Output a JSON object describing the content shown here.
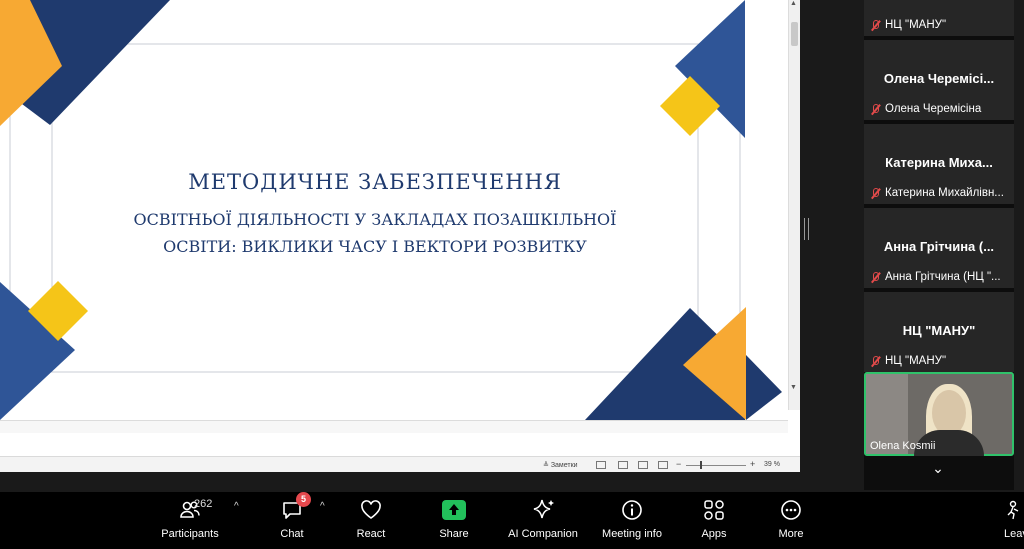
{
  "slide": {
    "title": "МЕТОДИЧНЕ ЗАБЕЗПЕЧЕННЯ",
    "subtitle_line1": "ОСВІТНЬОЇ ДІЯЛЬНОСТІ У ЗАКЛАДАХ ПОЗАШКІЛЬНОЇ",
    "subtitle_line2": "ОСВІТИ: ВИКЛИКИ ЧАСУ І ВЕКТОРИ РОЗВИТКУ",
    "colors": {
      "navy": "#1f3a6e",
      "yellow": "#f5c518",
      "orange": "#f7a933",
      "blue": "#2f5597"
    }
  },
  "ppt_status": {
    "notes_label": "Заметки",
    "zoom": "39 %"
  },
  "gallery": [
    {
      "display_name": "",
      "label": "НЦ \"МАНУ\""
    },
    {
      "display_name": "Олена Черемісі...",
      "label": "Олена Черемісіна"
    },
    {
      "display_name": "Катерина Миха...",
      "label": "Катерина Михайлівн..."
    },
    {
      "display_name": "Анна Грітчина (...",
      "label": "Анна Грітчина (НЦ \"..."
    },
    {
      "display_name": "НЦ \"МАНУ\"",
      "label": "НЦ \"МАНУ\""
    }
  ],
  "video": {
    "label": "Olena Kosmii"
  },
  "toolbar": {
    "participants_label": "Participants",
    "participants_count": "262",
    "chat_label": "Chat",
    "chat_badge": "5",
    "react_label": "React",
    "share_label": "Share",
    "ai_label": "AI Companion",
    "info_label": "Meeting info",
    "apps_label": "Apps",
    "more_label": "More",
    "leave_label": "Leave"
  }
}
